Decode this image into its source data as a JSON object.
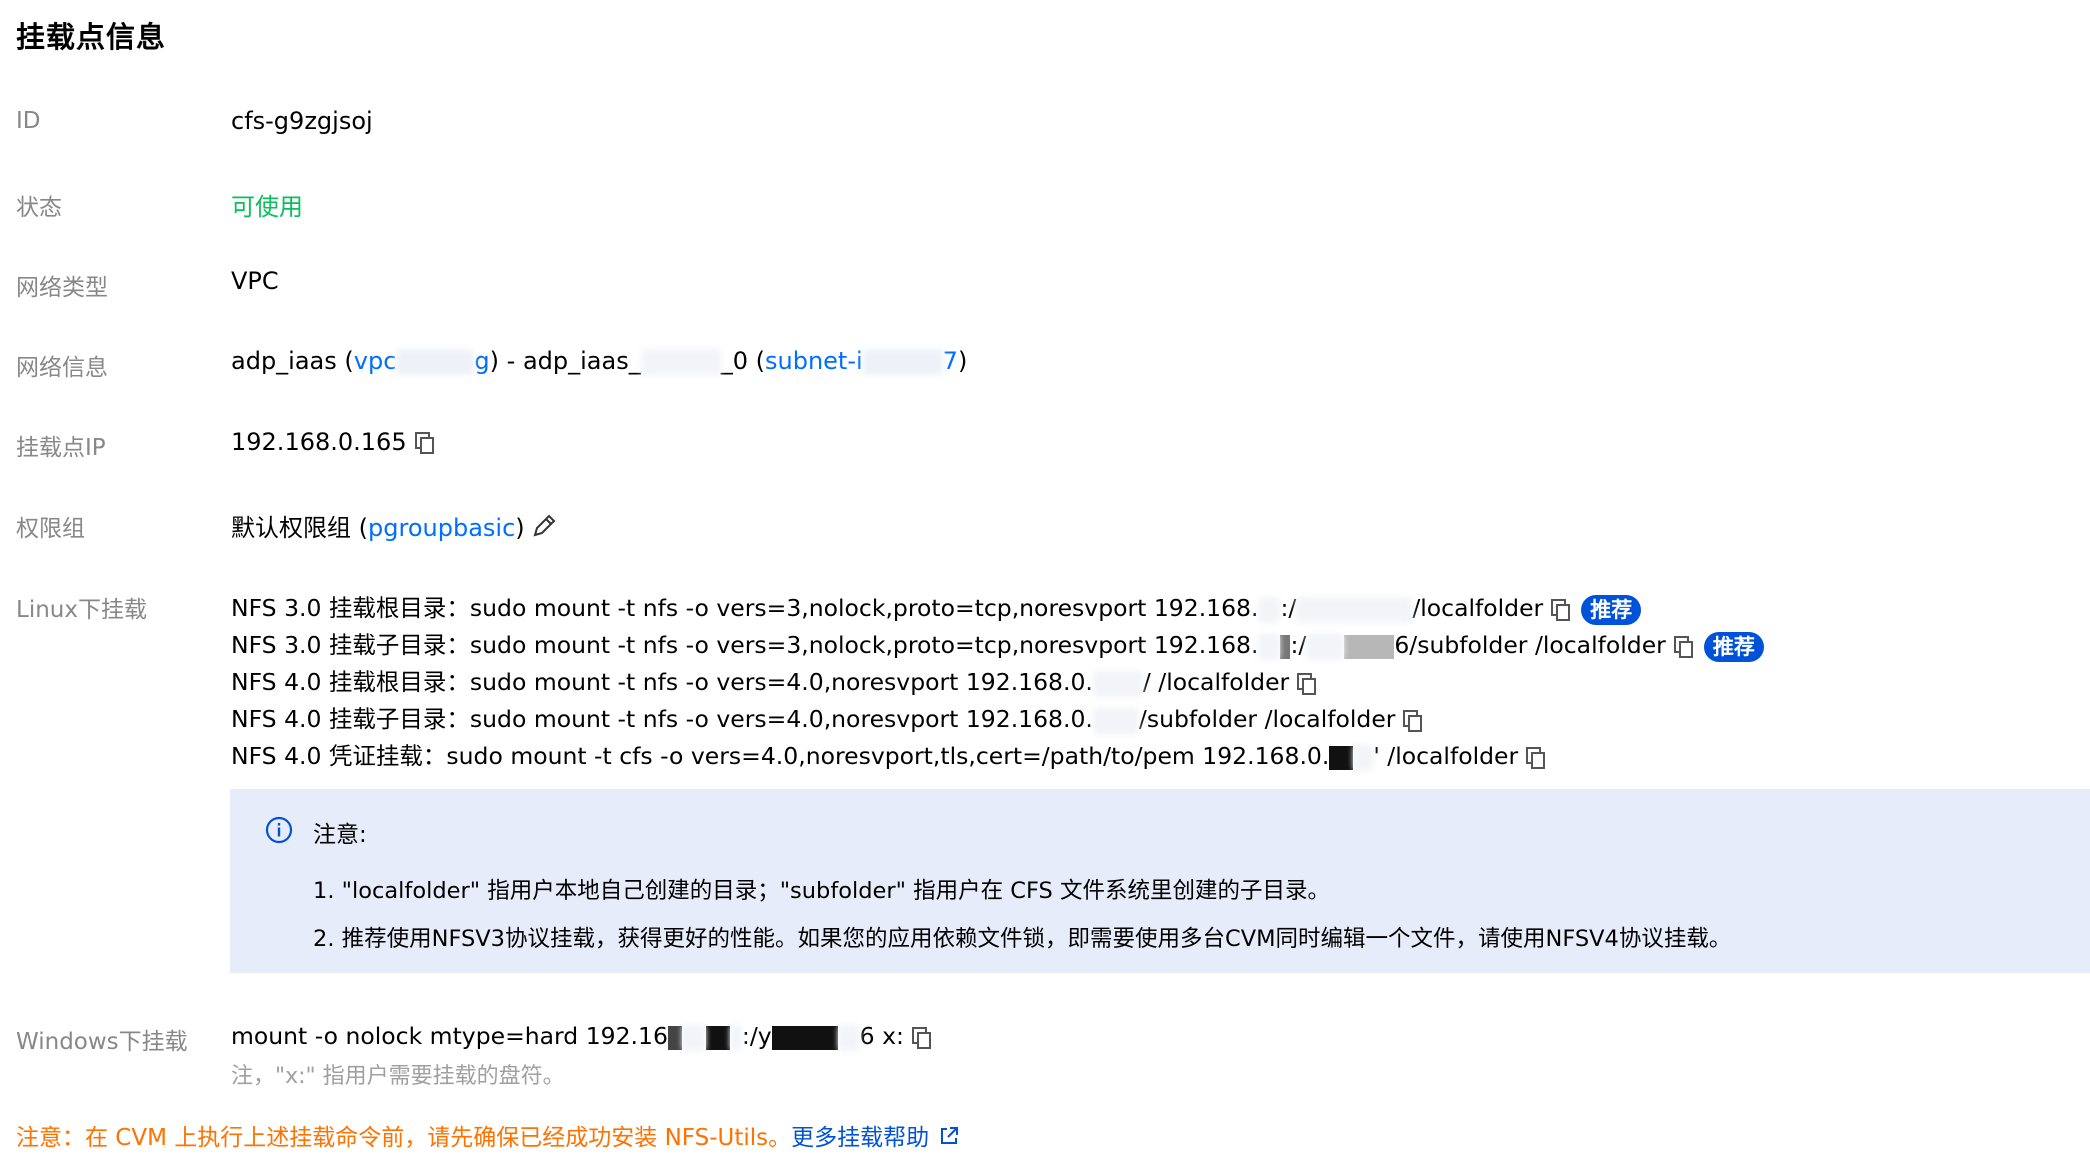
{
  "page": {
    "title": "挂载点信息"
  },
  "fields": {
    "id": {
      "label": "ID",
      "value": "cfs-g9zgjsoj"
    },
    "status": {
      "label": "状态",
      "value": "可使用",
      "color": "#0abf5b"
    },
    "network_type": {
      "label": "网络类型",
      "value": "VPC"
    },
    "network_info": {
      "label": "网络信息",
      "vpc_name": "adp_iaas",
      "open_paren": "(",
      "vpc_id_start": "vpc",
      "vpc_id_end": "g",
      "separator": ") - adp_iaas_",
      "subnet_suffix": "_0",
      "subnet_open": "(",
      "subnet_id_start": "subnet-i",
      "subnet_id_end": "7",
      "close_paren": ")"
    },
    "mount_ip": {
      "label": "挂载点IP",
      "value": "192.168.0.165"
    },
    "permission_group": {
      "label": "权限组",
      "name": "默认权限组",
      "open_paren": "(",
      "link": "pgroupbasic",
      "close_paren": ")"
    }
  },
  "linux": {
    "label": "Linux下挂载",
    "recommend_tag": "推荐",
    "commands": [
      {
        "prefix": "NFS 3.0 挂载根目录：sudo mount -t nfs -o vers=3,nolock,proto=tcp,noresvport 192.168.",
        "mid": ":/",
        "suffix": "/localfolder",
        "recommended": true
      },
      {
        "prefix": "NFS 3.0 挂载子目录：sudo mount -t nfs -o vers=3,nolock,proto=tcp,noresvport 192.168.",
        "mid": ":/",
        "suffix": "6/subfolder /localfolder",
        "recommended": true
      },
      {
        "prefix": "NFS 4.0 挂载根目录：sudo mount -t nfs -o vers=4.0,noresvport 192.168.0.",
        "mid": "",
        "suffix": "/ /localfolder",
        "recommended": false
      },
      {
        "prefix": "NFS 4.0 挂载子目录：sudo mount -t nfs -o vers=4.0,noresvport 192.168.0.",
        "mid": "",
        "suffix": "/subfolder /localfolder",
        "recommended": false
      },
      {
        "prefix": "NFS 4.0 凭证挂载：sudo mount -t cfs -o vers=4.0,noresvport,tls,cert=/path/to/pem 192.168.0.",
        "mid": "",
        "suffix": "' /localfolder",
        "recommended": false
      }
    ]
  },
  "notice": {
    "title": "注意:",
    "lines": [
      "1. \"localfolder\" 指用户本地自己创建的目录；\"subfolder\" 指用户在 CFS 文件系统里创建的子目录。",
      "2. 推荐使用NFSV3协议挂载，获得更好的性能。如果您的应用依赖文件锁，即需要使用多台CVM同时编辑一个文件，请使用NFSV4协议挂载。"
    ]
  },
  "windows": {
    "label": "Windows下挂载",
    "cmd_prefix": "mount -o nolock mtype=hard 192.16",
    "cmd_mid": ":/y",
    "cmd_suffix": "6 x:",
    "hint": "注，\"x:\" 指用户需要挂载的盘符。"
  },
  "footer": {
    "warning": "注意：在 CVM 上执行上述挂载命令前，请先确保已经成功安装 NFS-Utils。",
    "help_link": "更多挂载帮助"
  },
  "colors": {
    "link": "#006eff",
    "tag": "#0052d9",
    "warning": "#ff7200",
    "notice_bg": "#e7ecfb"
  }
}
